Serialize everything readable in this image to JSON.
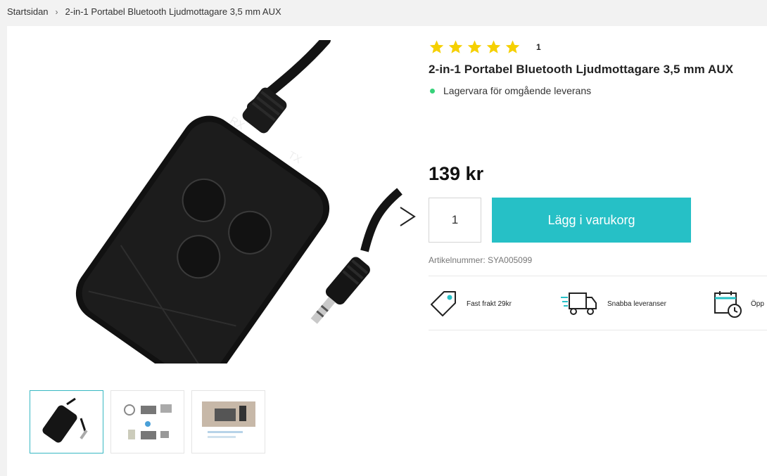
{
  "breadcrumb": {
    "home": "Startsidan",
    "separator": "›",
    "current": "2-in-1 Portabel Bluetooth Ljudmottagare 3,5 mm AUX"
  },
  "product": {
    "rating_stars": 5,
    "rating_count": "1",
    "title": "2-in-1 Portabel Bluetooth Ljudmottagare 3,5 mm AUX",
    "stock_text": "Lagervara för omgående leverans",
    "price": "139 kr",
    "quantity": "1",
    "add_to_cart_label": "Lägg i varukorg",
    "sku_text": "Artikelnummer: SYA005099",
    "device_labels": {
      "rx": "RX",
      "tx": "TX"
    }
  },
  "usps": [
    {
      "icon": "price-tag-icon",
      "label": "Fast frakt 29kr"
    },
    {
      "icon": "delivery-truck-icon",
      "label": "Snabba leveranser"
    },
    {
      "icon": "calendar-clock-icon",
      "label": "Öpp"
    }
  ],
  "colors": {
    "accent": "#26c0c6",
    "star": "#f5d000",
    "stock_dot": "#37d27a",
    "thumb_active": "#37b8c3"
  },
  "thumbnails": [
    {
      "name": "thumb-device",
      "active": true
    },
    {
      "name": "thumb-diagram",
      "active": false
    },
    {
      "name": "thumb-lifestyle",
      "active": false
    }
  ]
}
